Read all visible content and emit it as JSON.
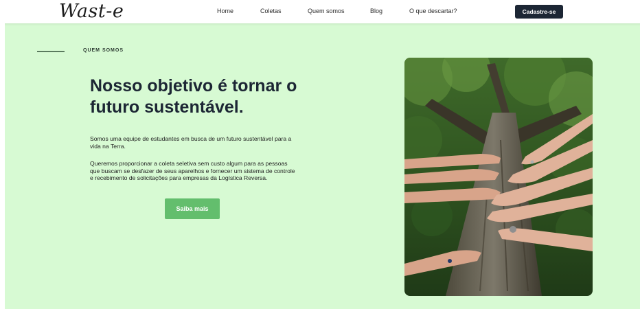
{
  "brand": {
    "logo_text": "Wast-e"
  },
  "nav": {
    "links": [
      {
        "label": "Home"
      },
      {
        "label": "Coletas"
      },
      {
        "label": "Quem somos"
      },
      {
        "label": "Blog"
      },
      {
        "label": "O que descartar?"
      }
    ],
    "signup_label": "Cadastre-se"
  },
  "hero": {
    "eyebrow": "QUEM SOMOS",
    "headline": "Nosso objetivo é tornar o futuro sustentável.",
    "paragraph_1": "Somos uma equipe de estudantes em busca de um futuro sustentável para a vida na Terra.",
    "paragraph_2": "Queremos proporcionar a coleta seletiva sem custo algum para as pessoas que buscam se desfazer de seus aparelhos e fornecer um sistema de controle e recebimento de solicitações para empresas da Logística Reversa.",
    "cta_label": "Saiba mais",
    "image_icon": "hands-on-tree-photo"
  },
  "colors": {
    "hero_background": "#d7fad3",
    "primary_dark": "#1c2634",
    "cta_green": "#63be6d"
  }
}
